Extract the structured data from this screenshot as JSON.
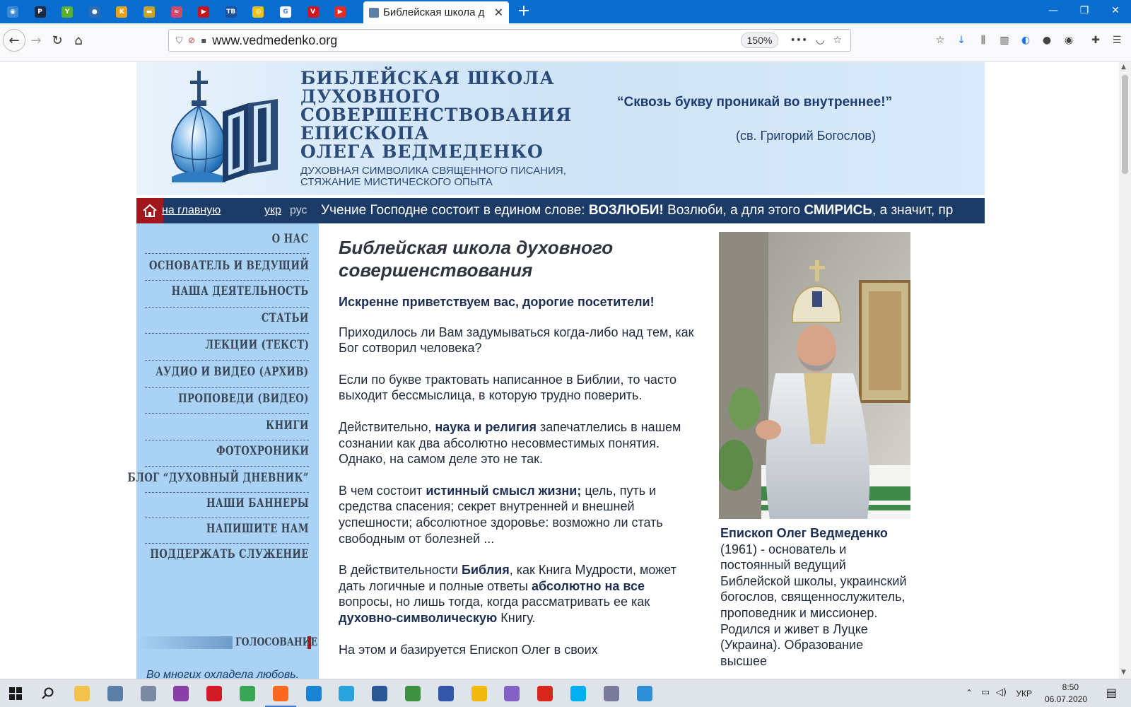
{
  "browser": {
    "active_tab_title": "Библейская школа д",
    "url": "www.vedmedenko.org",
    "zoom": "150%",
    "pinned_tabs": [
      {
        "name": "pin-tab-1",
        "color": "#3b8bd6",
        "glyph": "◉"
      },
      {
        "name": "pin-tab-2",
        "color": "#1e2a44",
        "glyph": "P"
      },
      {
        "name": "pin-tab-3",
        "color": "#59b02b",
        "glyph": "Y"
      },
      {
        "name": "pin-tab-4",
        "color": "#2f6db0",
        "glyph": "●"
      },
      {
        "name": "pin-tab-5",
        "color": "#e8a21a",
        "glyph": "K"
      },
      {
        "name": "pin-tab-6",
        "color": "#c9a227",
        "glyph": "▬"
      },
      {
        "name": "pin-tab-7",
        "color": "#d04a6a",
        "glyph": "≈"
      },
      {
        "name": "pin-tab-8",
        "color": "#c4161c",
        "glyph": "▶"
      },
      {
        "name": "pin-tab-9",
        "color": "#1d4f9a",
        "glyph": "TB"
      },
      {
        "name": "pin-tab-10",
        "color": "#e8c31a",
        "glyph": "◎"
      },
      {
        "name": "pin-tab-11",
        "color": "#ffffff",
        "glyph": "G"
      },
      {
        "name": "pin-tab-12",
        "color": "#d4171f",
        "glyph": "V"
      },
      {
        "name": "pin-tab-13",
        "color": "#e52d27",
        "glyph": "▶"
      }
    ]
  },
  "site": {
    "title_lines": [
      "БИБЛЕЙСКАЯ ШКОЛА",
      "ДУХОВНОГО",
      "СОВЕРШЕНСТВОВАНИЯ",
      "ЕПИСКОПА",
      "ОЛЕГА ВЕДМЕДЕНКО"
    ],
    "subtitle_lines": [
      "ДУХОВНАЯ СИМВОЛИКА СВЯЩЕННОГО ПИСАНИЯ,",
      "СТЯЖАНИЕ МИСТИЧЕСКОГО ОПЫТА"
    ],
    "motto": "“Сквозь букву проникай во внутреннее!”",
    "motto_author": "(св. Григорий Богослов)",
    "home_link": "на главную",
    "lang_ukr": "укр",
    "lang_rus": "рус",
    "ticker_1": "Учение Господне состоит в едином слове: ",
    "ticker_b1": "ВОЗЛЮБИ!",
    "ticker_2": " Возлюби, а для этого ",
    "ticker_b2": "СМИРИСЬ",
    "ticker_3": ", а значит, пр"
  },
  "sidebar": {
    "items": [
      "О НАС",
      "ОСНОВАТЕЛЬ И ВЕДУЩИЙ",
      "НАША ДЕЯТЕЛЬНОСТЬ",
      "СТАТЬИ",
      "ЛЕКЦИИ (ТЕКСТ)",
      "АУДИО И ВИДЕО (АРХИВ)",
      "ПРОПОВЕДИ (ВИДЕО)",
      "КНИГИ",
      "ФОТОХРОНИКИ",
      "БЛОГ “ДУХОВНЫЙ ДНЕВНИК”",
      "НАШИ БАННЕРЫ",
      "НАПИШИТЕ НАМ",
      "ПОДДЕРЖАТЬ СЛУЖЕНИЕ"
    ],
    "vote_label": "ГОЛОСОВАНИЕ",
    "quote": "Во многих охладела любовь."
  },
  "main": {
    "heading": "Библейская школа духовного совершенствования",
    "greeting": "Искренне приветствуем вас, дорогие посетители!",
    "p1": "Приходилось ли Вам задумываться когда-либо над тем, как Бог сотворил человека?",
    "p2": "Если по букве трактовать написанное в Библии, то часто выходит бессмыслица, в которую трудно поверить.",
    "p3a": "Действительно, ",
    "p3b": "наука и религия",
    "p3c": " запечатлелись в нашем сознании как два абсолютно несовместимых понятия. Однако, на самом деле это не так.",
    "p4a": "В чем состоит ",
    "p4b": "истинный смысл жизни;",
    "p4c": " цель, путь и средства спасения; секрет внутренней и внешней успешности; абсолютное здоровье: возможно ли стать свободным от болезней ...",
    "p5a": "В действительности ",
    "p5b": "Библия",
    "p5c": ", как Книга Мудрости, может дать логичные и полные ответы ",
    "p5d": "абсолютно на все",
    "p5e": " вопросы, но лишь тогда, когда рассматривать ее как ",
    "p5f": "духовно-символическую",
    "p5g": " Книгу.",
    "p6": "На этом и базируется Епископ Олег в своих"
  },
  "side": {
    "caption_name": "Епископ Олег Ведмеденко",
    "caption_text": "(1961) - основатель и постоянный ведущий Библейской школы, украинский богослов, священнослужитель, проповедник и миссионер. Родился и живет в Луцке (Украина). Образование высшее"
  },
  "taskbar": {
    "lang": "УКР",
    "time": "8:50",
    "date": "06.07.2020",
    "apps": [
      {
        "name": "explorer-app",
        "color": "#f2c24b"
      },
      {
        "name": "calculator-app",
        "color": "#5b7fa6"
      },
      {
        "name": "satellite-app",
        "color": "#7a8aa0"
      },
      {
        "name": "notes-app",
        "color": "#8a3ea8"
      },
      {
        "name": "opera-app",
        "color": "#d21b26"
      },
      {
        "name": "chrome-app",
        "color": "#3aa757"
      },
      {
        "name": "firefox-app",
        "color": "#ff6a1f"
      },
      {
        "name": "edge-app",
        "color": "#1b83d4"
      },
      {
        "name": "telegram-app",
        "color": "#2aa3dd"
      },
      {
        "name": "word-app",
        "color": "#2b5797"
      },
      {
        "name": "spreadsheet-app",
        "color": "#3f9142"
      },
      {
        "name": "disk-app",
        "color": "#3456a8"
      },
      {
        "name": "warning-app",
        "color": "#f0b90b"
      },
      {
        "name": "vs-app",
        "color": "#8661c5"
      },
      {
        "name": "download-app",
        "color": "#d9261c"
      },
      {
        "name": "skype-app",
        "color": "#00aff0"
      },
      {
        "name": "swirl-app",
        "color": "#7a7a9a"
      },
      {
        "name": "globe-app",
        "color": "#2f8fd8"
      }
    ]
  }
}
